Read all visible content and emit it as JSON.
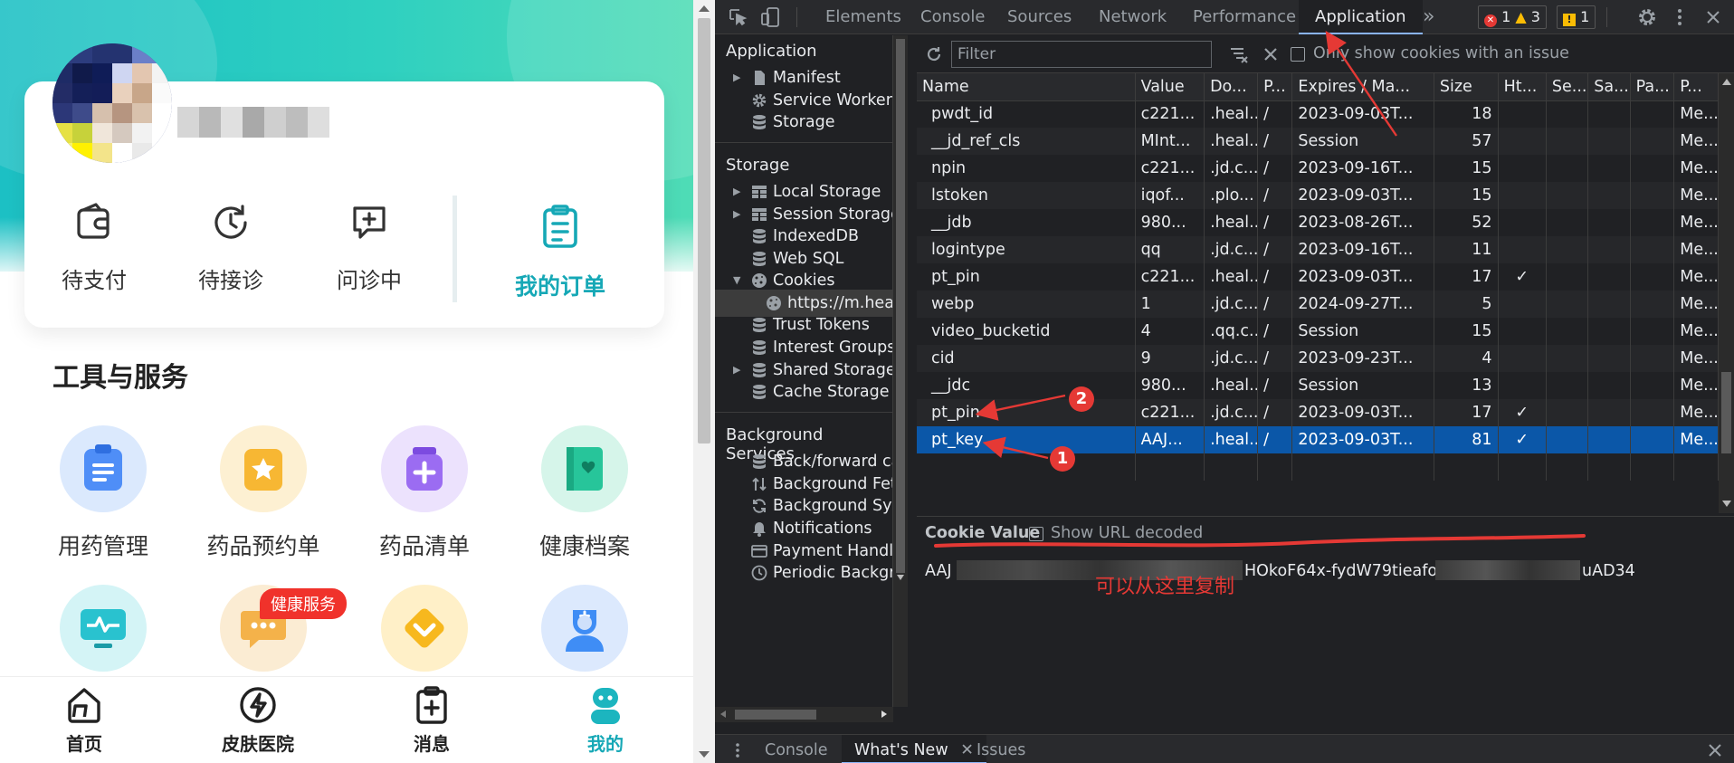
{
  "mobile": {
    "orders": [
      {
        "label": "待支付",
        "icon": "wallet-icon"
      },
      {
        "label": "待接诊",
        "icon": "clock-icon"
      },
      {
        "label": "问诊中",
        "icon": "chat-plus-icon"
      }
    ],
    "my_orders_label": "我的订单",
    "section_title": "工具与服务",
    "tools": [
      {
        "label": "用药管理",
        "icon": "medicine-list-icon",
        "color": "#4f8ef7"
      },
      {
        "label": "药品预约单",
        "icon": "star-clipboard-icon",
        "color": "#f7b733"
      },
      {
        "label": "药品清单",
        "icon": "medicine-jar-icon",
        "color": "#9b6cf2"
      },
      {
        "label": "健康档案",
        "icon": "health-record-icon",
        "color": "#27c59a"
      },
      {
        "label": "",
        "icon": "monitor-pulse-icon",
        "color": "#29c2cf"
      },
      {
        "label": "",
        "icon": "message-dots-icon",
        "color": "#f4b24a"
      },
      {
        "label": "",
        "icon": "coupon-diamond-icon",
        "color": "#f7b81e"
      },
      {
        "label": "",
        "icon": "doctor-icon",
        "color": "#3f8df5"
      }
    ],
    "badge": "健康服务",
    "tabbar": [
      {
        "label": "首页",
        "icon": "home-icon",
        "active": false
      },
      {
        "label": "皮肤医院",
        "icon": "bolt-circle-icon",
        "active": false
      },
      {
        "label": "消息",
        "icon": "clipboard-plus-icon",
        "active": false
      },
      {
        "label": "我的",
        "icon": "profile-icon",
        "active": true
      }
    ],
    "accent": "#16a8b6"
  },
  "devtools": {
    "tabs": [
      "Elements",
      "Console",
      "Sources",
      "Network",
      "Performance",
      "Application"
    ],
    "active_tab": "Application",
    "more": "»",
    "errors": "1",
    "warnings": "3",
    "issues": "1",
    "sidebar": {
      "application_header": "Application",
      "application_items": [
        "Manifest",
        "Service Workers",
        "Storage"
      ],
      "storage_header": "Storage",
      "storage_items": [
        "Local Storage",
        "Session Storage",
        "IndexedDB",
        "Web SQL",
        "Cookies",
        "https://m.heal",
        "Trust Tokens",
        "Interest Groups",
        "Shared Storage",
        "Cache Storage"
      ],
      "background_header": "Background Services",
      "background_items": [
        "Back/forward cac",
        "Background Fetc",
        "Background Sync",
        "Notifications",
        "Payment Handle",
        "Periodic Backgro"
      ]
    },
    "toolbar": {
      "filter_placeholder": "Filter",
      "only_issue_label": "Only show cookies with an issue"
    },
    "columns": [
      "Name",
      "Value",
      "Do...",
      "P...",
      "Expires / Ma...",
      "Size",
      "Ht...",
      "Se...",
      "Sa...",
      "Pa...",
      "P..."
    ],
    "rows": [
      {
        "name": "pwdt_id",
        "value": "c221...",
        "domain": ".heal...",
        "path": "/",
        "expires": "2023-09-03T...",
        "size": "18",
        "http": "",
        "priority": "Me..."
      },
      {
        "name": "__jd_ref_cls",
        "value": "MInt...",
        "domain": ".heal...",
        "path": "/",
        "expires": "Session",
        "size": "57",
        "http": "",
        "priority": "Me..."
      },
      {
        "name": "npin",
        "value": "c221...",
        "domain": ".jd.c...",
        "path": "/",
        "expires": "2023-09-16T...",
        "size": "15",
        "http": "",
        "priority": "Me..."
      },
      {
        "name": "lstoken",
        "value": "iqof...",
        "domain": ".plo...",
        "path": "/",
        "expires": "2023-09-03T...",
        "size": "15",
        "http": "",
        "priority": "Me..."
      },
      {
        "name": "__jdb",
        "value": "980...",
        "domain": ".heal...",
        "path": "/",
        "expires": "2023-08-26T...",
        "size": "52",
        "http": "",
        "priority": "Me..."
      },
      {
        "name": "logintype",
        "value": "qq",
        "domain": ".jd.c...",
        "path": "/",
        "expires": "2023-09-16T...",
        "size": "11",
        "http": "",
        "priority": "Me..."
      },
      {
        "name": "pt_pin",
        "value": "c221...",
        "domain": ".heal...",
        "path": "/",
        "expires": "2023-09-03T...",
        "size": "17",
        "http": "✓",
        "priority": "Me..."
      },
      {
        "name": "webp",
        "value": "1",
        "domain": ".jd.c...",
        "path": "/",
        "expires": "2024-09-27T...",
        "size": "5",
        "http": "",
        "priority": "Me..."
      },
      {
        "name": "video_bucketid",
        "value": "4",
        "domain": ".qq.c...",
        "path": "/",
        "expires": "Session",
        "size": "15",
        "http": "",
        "priority": "Me..."
      },
      {
        "name": "cid",
        "value": "9",
        "domain": ".jd.c...",
        "path": "/",
        "expires": "2023-09-23T...",
        "size": "4",
        "http": "",
        "priority": "Me..."
      },
      {
        "name": "__jdc",
        "value": "980...",
        "domain": ".heal...",
        "path": "/",
        "expires": "Session",
        "size": "13",
        "http": "",
        "priority": "Me..."
      },
      {
        "name": "pt_pin",
        "value": "c221...",
        "domain": ".jd.c...",
        "path": "/",
        "expires": "2023-09-03T...",
        "size": "17",
        "http": "✓",
        "priority": "Me..."
      },
      {
        "name": "pt_key",
        "value": "AAJ...",
        "domain": ".heal...",
        "path": "/",
        "expires": "2023-09-03T...",
        "size": "81",
        "http": "✓",
        "priority": "Me...",
        "selected": true
      }
    ],
    "cookie_value": {
      "title": "Cookie Value",
      "show_url_decoded": "Show URL decoded",
      "prefix": "AAJ",
      "middle": "HOkoF64x-fydW79tieafo",
      "suffix": "uAD34"
    },
    "annotation_text": "可以从这里复制",
    "pins": [
      "1",
      "2"
    ],
    "drawer_tabs": [
      "Console",
      "What's New",
      "Issues"
    ],
    "drawer_active": "What's New",
    "colors": {
      "selection": "#0b57a8",
      "annotation": "#e53935",
      "link_accent": "#8ab4f8"
    }
  }
}
